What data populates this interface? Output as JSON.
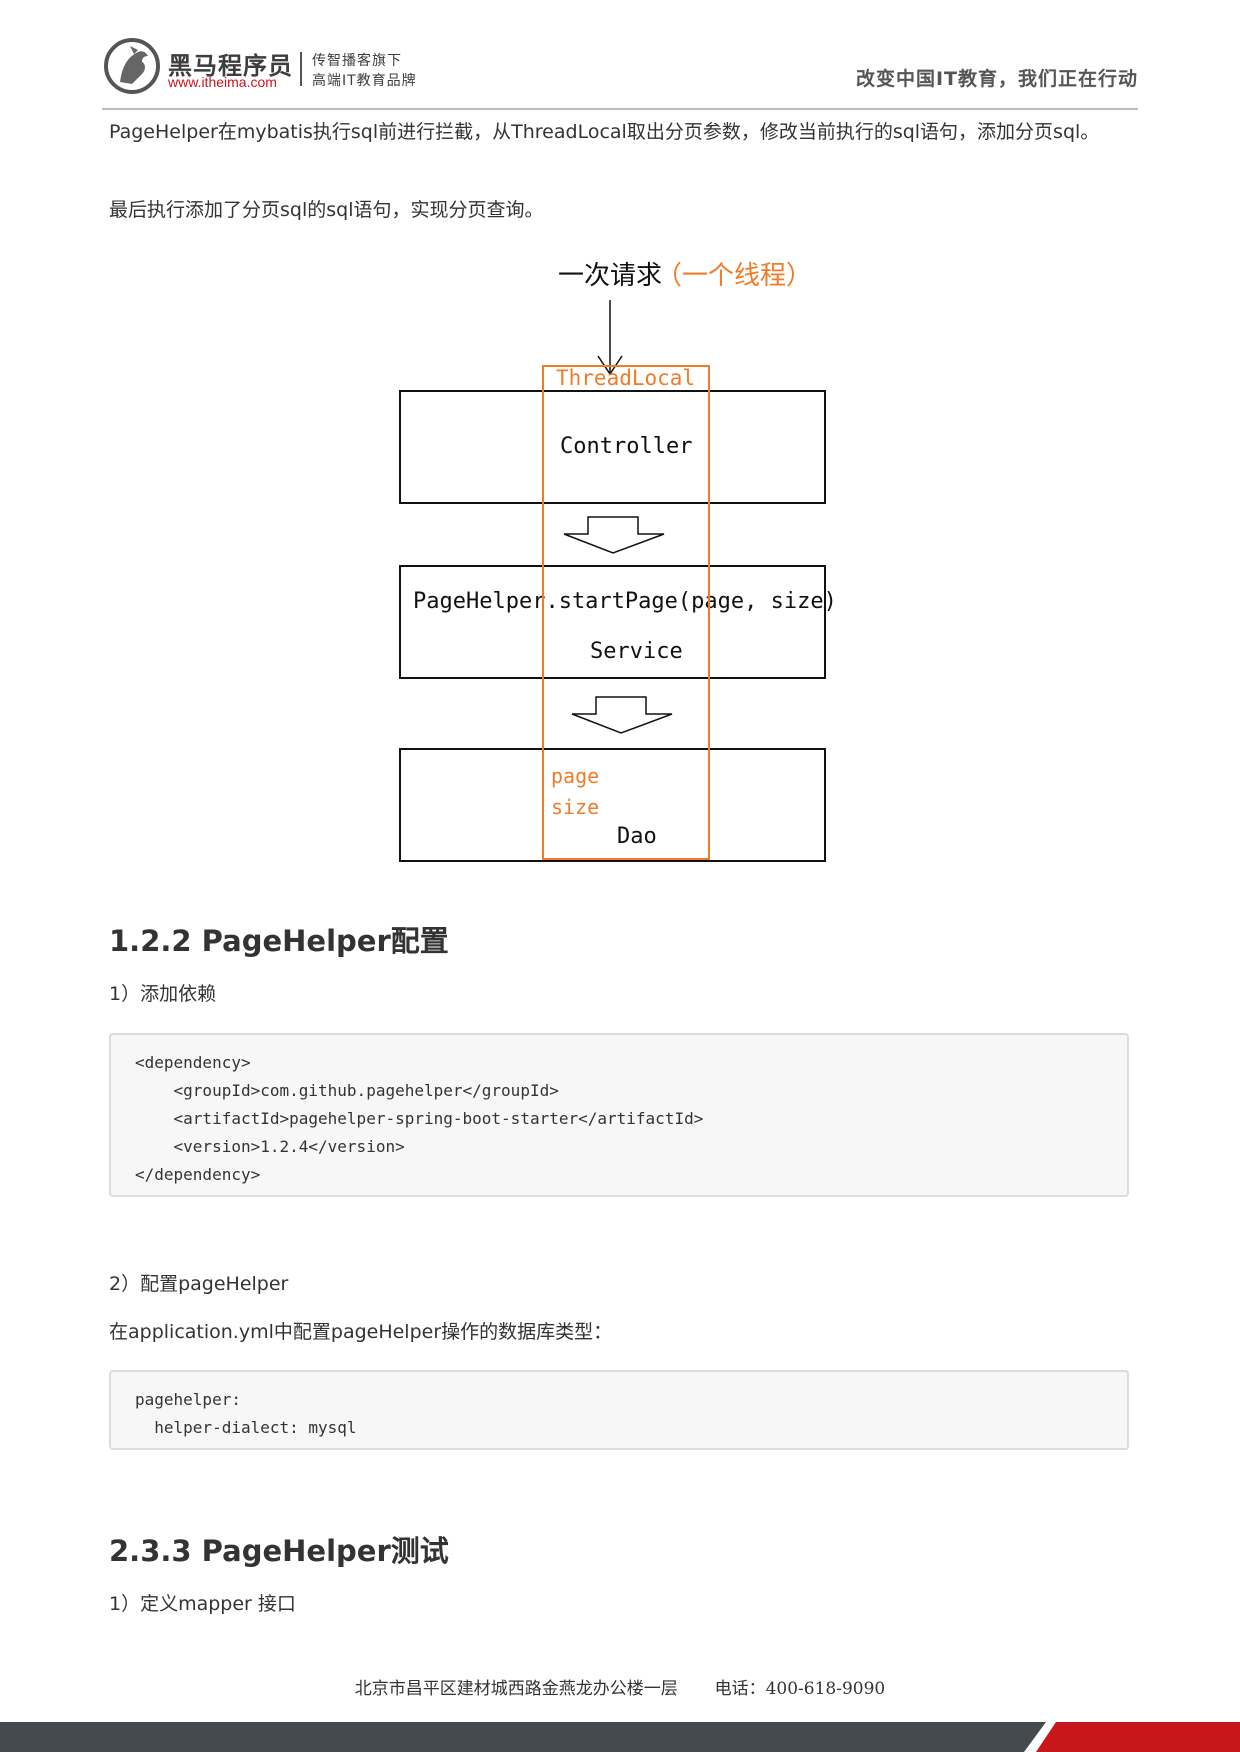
{
  "header": {
    "brand_cn": "黑马程序员",
    "brand_url": "www.itheima.com",
    "tagline_line1": "传智播客旗下",
    "tagline_line2": "高端IT教育品牌",
    "slogan": "改变中国IT教育，我们正在行动",
    "logo_icon": "horse-logo-icon"
  },
  "content": {
    "para1": "PageHelper在mybatis执行sql前进行拦截，从ThreadLocal取出分页参数，修改当前执行的sql语句，添加分页sql。",
    "para2": "最后执行添加了分页sql的sql语句，实现分页查询。",
    "diagram": {
      "request_label": "一次请求",
      "thread_label": "（一个线程）",
      "threadlocal_label": "ThreadLocal",
      "controller_label": "Controller",
      "service_call_label": "PageHelper.startPage(page, size)",
      "service_label": "Service",
      "dao_label": "Dao",
      "page_param": "page",
      "size_param": "size"
    },
    "section1_title": "1.2.2 PageHelper配置",
    "step1_label": "1）添加依赖",
    "code1": [
      "<dependency>",
      "    <groupId>com.github.pagehelper</groupId>",
      "    <artifactId>pagehelper-spring-boot-starter</artifactId>",
      "    <version>1.2.4</version>",
      "</dependency>"
    ],
    "step2_label": "2）配置pageHelper",
    "step2_desc": "在application.yml中配置pageHelper操作的数据库类型：",
    "code2": [
      "pagehelper:",
      "  helper-dialect: mysql"
    ],
    "section2_title": "2.3.3 PageHelper测试",
    "step3_label": "1）定义mapper 接口"
  },
  "footer": {
    "address": "北京市昌平区建材城西路金燕龙办公楼一层",
    "phone": "电话：400-618-9090"
  },
  "colors": {
    "accent_orange": "#f07c2a",
    "brand_red": "#c8161d",
    "footer_dark": "#454a4e"
  }
}
